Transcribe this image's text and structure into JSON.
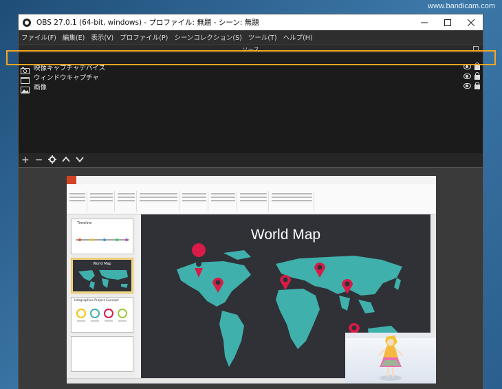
{
  "watermark": "www.bandicam.com",
  "window": {
    "title": "OBS 27.0.1 (64-bit, windows) - プロファイル: 無題 - シーン: 無題",
    "controls": [
      "minimize",
      "maximize",
      "close"
    ]
  },
  "menu": [
    "ファイル(F)",
    "編集(E)",
    "表示(V)",
    "プロファイル(P)",
    "シーンコレクション(S)",
    "ツール(T)",
    "ヘルプ(H)"
  ],
  "sources_panel": {
    "title": "ソース",
    "items": [
      {
        "label": "映像キャプチャデバイス",
        "icon": "camera-icon",
        "selected": true
      },
      {
        "label": "ウィンドウキャプチャ",
        "icon": "window-icon",
        "selected": false
      },
      {
        "label": "画像",
        "icon": "image-icon",
        "selected": false
      }
    ],
    "toolbar": [
      "add-icon",
      "remove-icon",
      "gear-icon",
      "move-up-icon",
      "move-down-icon"
    ]
  },
  "preview": {
    "slide_title": "World Map",
    "thumbnails": [
      {
        "label": "Timeline",
        "selected": false
      },
      {
        "label": "World Map",
        "selected": true
      },
      {
        "label": "Infographics  Project Concept",
        "selected": false
      },
      {
        "label": "",
        "selected": false
      }
    ]
  },
  "colors": {
    "highlight": "#f5a623",
    "map_land": "#3fb0ac",
    "map_pin": "#d81b47",
    "slide_bg": "#2f3137"
  }
}
